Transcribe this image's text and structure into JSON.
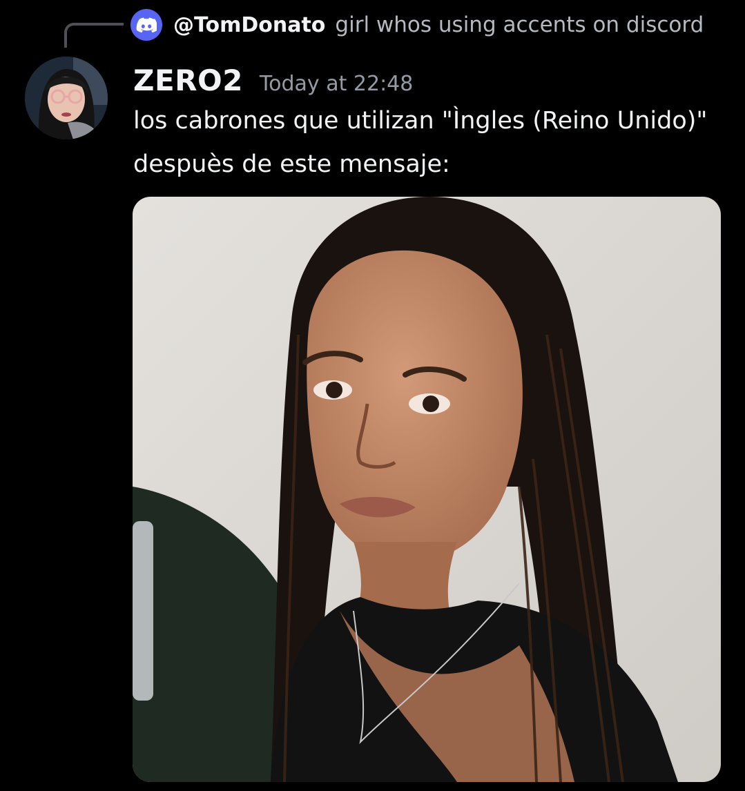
{
  "reply": {
    "author": "@TomDonato",
    "text": "girl whos using accents on discord",
    "avatar_icon": "discord-logo-icon",
    "avatar_color": "#5865f2"
  },
  "message": {
    "author": "ZERO2",
    "timestamp": "Today at 22:48",
    "lines": [
      "los cabrones que utilizan \"Ìngles (Reino Unido)\"",
      "despuès de este mensaje:"
    ]
  },
  "colors": {
    "background": "#000000",
    "author": "#f2f3f5",
    "timestamp": "#949ba4",
    "reply_text": "#b5bac1"
  }
}
